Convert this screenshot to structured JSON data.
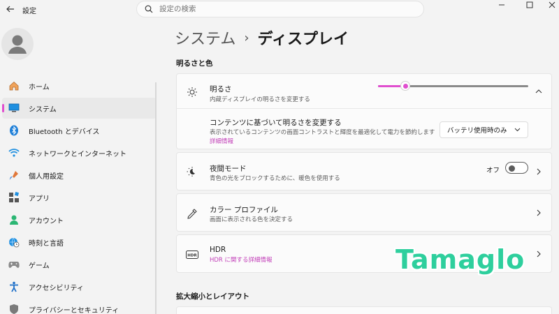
{
  "window": {
    "title": "設定"
  },
  "search": {
    "placeholder": "設定の検索"
  },
  "sidebar": {
    "items": [
      {
        "label": "ホーム",
        "icon": "home-icon"
      },
      {
        "label": "システム",
        "icon": "monitor-icon",
        "active": true
      },
      {
        "label": "Bluetooth とデバイス",
        "icon": "bluetooth-icon"
      },
      {
        "label": "ネットワークとインターネット",
        "icon": "wifi-icon"
      },
      {
        "label": "個人用設定",
        "icon": "brush-icon"
      },
      {
        "label": "アプリ",
        "icon": "apps-icon"
      },
      {
        "label": "アカウント",
        "icon": "account-icon"
      },
      {
        "label": "時刻と言語",
        "icon": "globe-clock-icon"
      },
      {
        "label": "ゲーム",
        "icon": "gamepad-icon"
      },
      {
        "label": "アクセシビリティ",
        "icon": "accessibility-icon"
      },
      {
        "label": "プライバシーとセキュリティ",
        "icon": "shield-icon"
      }
    ]
  },
  "breadcrumb": {
    "parent": "システム",
    "separator": "›",
    "current": "ディスプレイ"
  },
  "sections": {
    "brightness_color": "明るさと色",
    "scale_layout": "拡大縮小とレイアウト"
  },
  "brightness": {
    "title": "明るさ",
    "subtitle": "内蔵ディスプレイの明るさを変更する",
    "value_fraction": 0.18
  },
  "content_adaptive": {
    "title": "コンテンツに基づいて明るさを変更する",
    "subtitle": "表示されているコンテンツの画面コントラストと輝度を最適化して電力を節約します",
    "link": "詳細情報",
    "dropdown_value": "バッテリ使用時のみ"
  },
  "night_light": {
    "title": "夜間モード",
    "subtitle": "青色の光をブロックするために、暖色を使用する",
    "toggle_label": "オフ",
    "toggle_on": false
  },
  "color_profile": {
    "title": "カラー プロファイル",
    "subtitle": "画面に表示される色を決定する"
  },
  "hdr": {
    "title": "HDR",
    "link": "HDR に関する詳細情報"
  },
  "watermark": "Tamaglo",
  "colors": {
    "accent": "#e04ecf",
    "watermark": "#2ecf9d"
  }
}
